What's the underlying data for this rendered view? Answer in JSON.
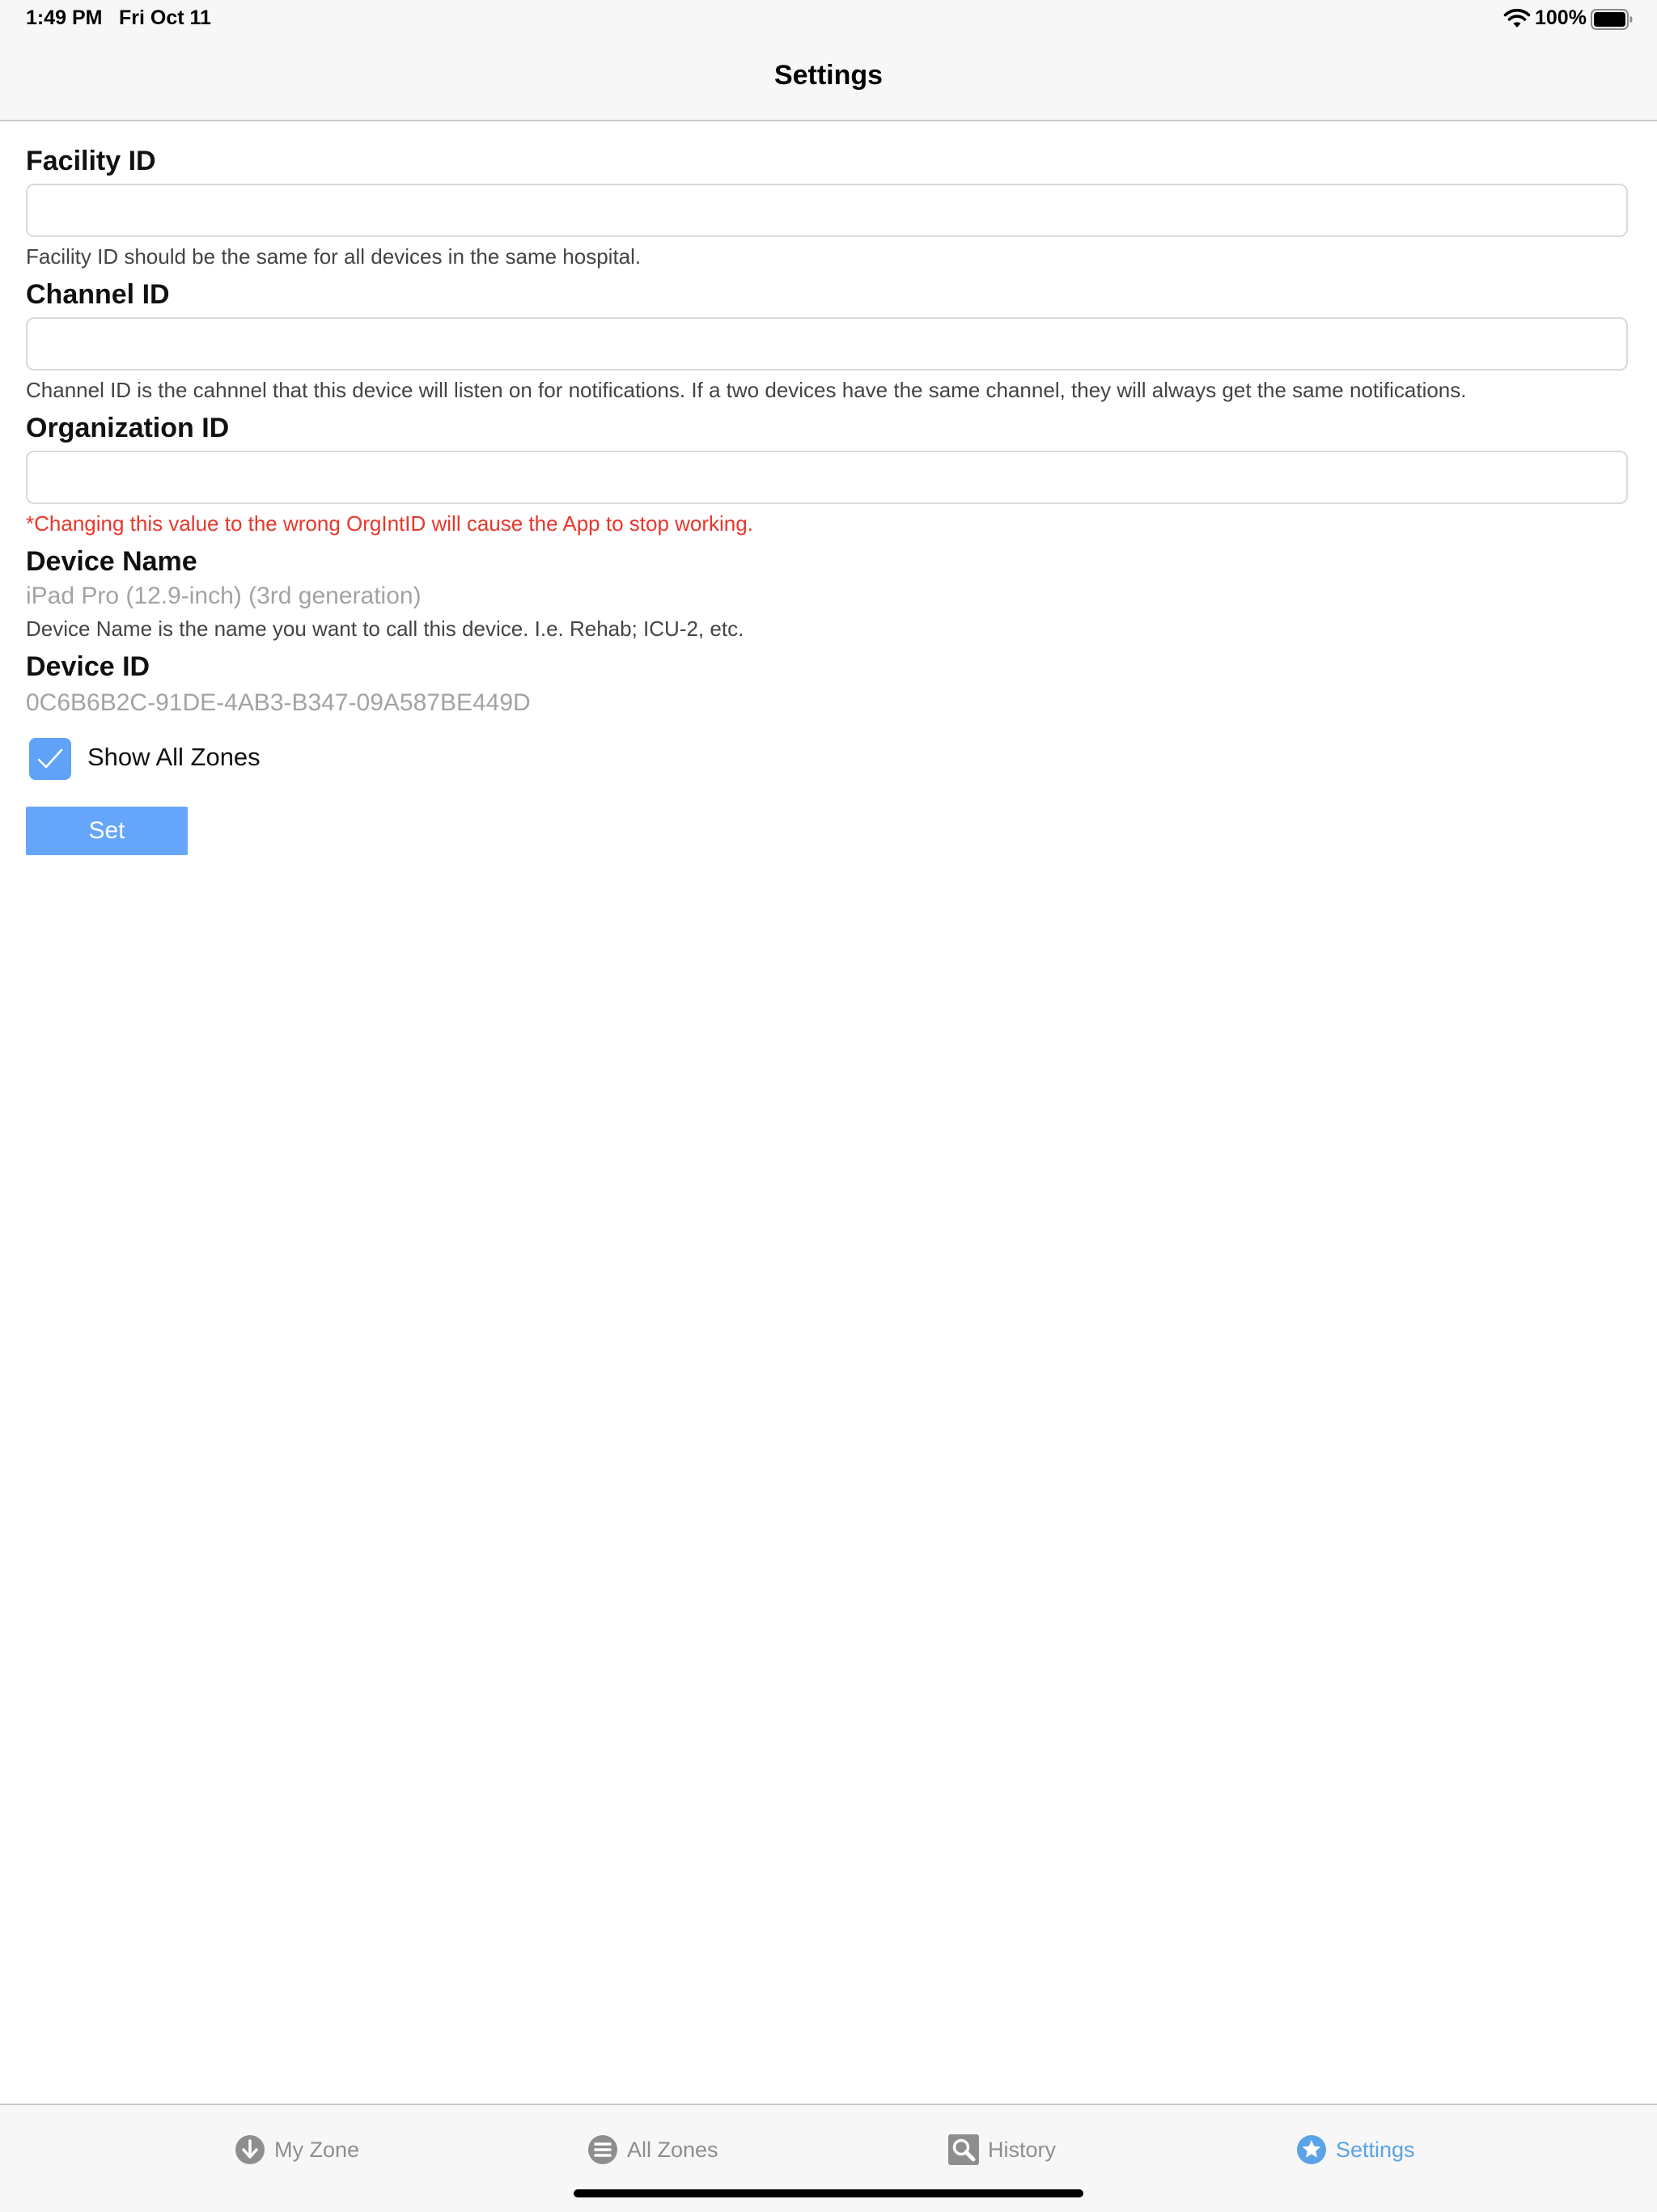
{
  "status_bar": {
    "time": "1:49 PM",
    "date": "Fri Oct 11",
    "battery_percent": "100%",
    "battery_level": 1.0
  },
  "nav": {
    "title": "Settings"
  },
  "form": {
    "facility": {
      "label": "Facility ID",
      "value": "",
      "help": "Facility ID should be the same for all devices in the same hospital."
    },
    "channel": {
      "label": "Channel ID",
      "value": "",
      "help": "Channel ID is the cahnnel that this device will listen on for notifications. If a two devices have the same channel, they will always get the same notifications."
    },
    "organization": {
      "label": "Organization ID",
      "value": "",
      "warning": "*Changing this value to the wrong OrgIntID will cause the App to stop working."
    },
    "device_name": {
      "label": "Device Name",
      "value": "iPad Pro (12.9-inch) (3rd generation)",
      "help": "Device Name is the name you want to call this device. I.e. Rehab; ICU-2, etc."
    },
    "device_id": {
      "label": "Device ID",
      "value": "0C6B6B2C-91DE-4AB3-B347-09A587BE449D"
    },
    "show_all_zones": {
      "label": "Show All Zones",
      "checked": true
    },
    "set_button_label": "Set"
  },
  "tabs": [
    {
      "label": "My Zone",
      "icon": "arrow-down-circle-icon",
      "active": false
    },
    {
      "label": "All Zones",
      "icon": "list-circle-icon",
      "active": false
    },
    {
      "label": "History",
      "icon": "magnifier-icon",
      "active": false
    },
    {
      "label": "Settings",
      "icon": "star-circle-icon",
      "active": true
    }
  ],
  "colors": {
    "accent": "#5aa3e6",
    "button": "#66a6fa",
    "warning": "#e8382b",
    "inactive_tab": "#8e8e8e"
  }
}
